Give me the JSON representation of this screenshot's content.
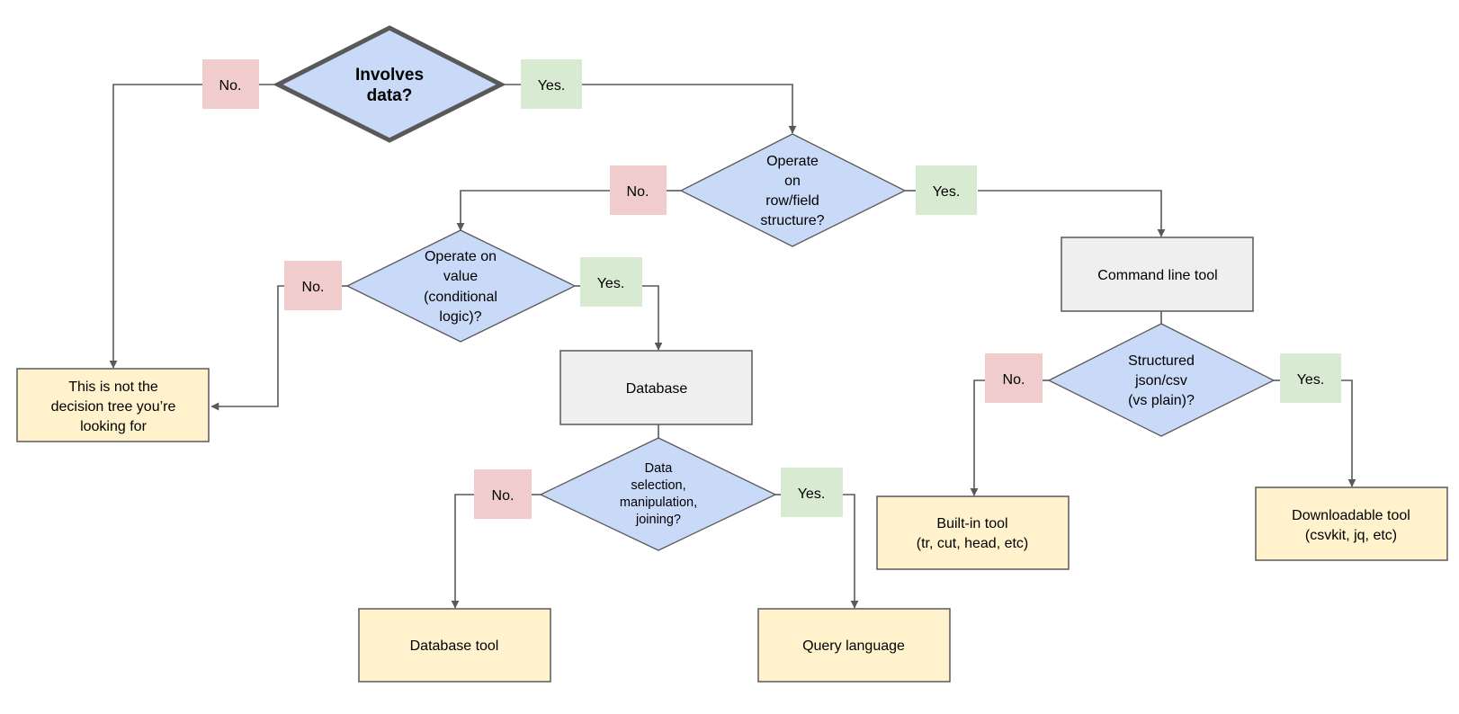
{
  "diagram": {
    "type": "decision-flowchart",
    "colors": {
      "decision_fill": "#c9daf8",
      "process_fill": "#efefef",
      "outcome_fill": "#fff2cc",
      "no_label_fill": "#f0cdcc",
      "yes_label_fill": "#d9ead3",
      "stroke": "#595959"
    },
    "labels": {
      "no": "No.",
      "yes": "Yes."
    },
    "nodes": {
      "involves_data": {
        "kind": "decision",
        "lines": [
          "Involves",
          "data?"
        ]
      },
      "row_field": {
        "kind": "decision",
        "lines": [
          "Operate",
          "on",
          "row/field",
          "structure?"
        ]
      },
      "value_logic": {
        "kind": "decision",
        "lines": [
          "Operate on",
          "value",
          "(conditional",
          "logic)?"
        ]
      },
      "not_this_tree": {
        "kind": "outcome",
        "lines": [
          "This is not the",
          "decision tree you’re",
          "looking for"
        ]
      },
      "database": {
        "kind": "process",
        "lines": [
          "Database"
        ]
      },
      "data_selection": {
        "kind": "decision",
        "lines": [
          "Data",
          "selection,",
          "manipulation,",
          "joining?"
        ]
      },
      "database_tool": {
        "kind": "outcome",
        "lines": [
          "Database tool"
        ]
      },
      "query_language": {
        "kind": "outcome",
        "lines": [
          "Query language"
        ]
      },
      "command_line_tool": {
        "kind": "process",
        "lines": [
          "Command line tool"
        ]
      },
      "structured": {
        "kind": "decision",
        "lines": [
          "Structured",
          "json/csv",
          "(vs plain)?"
        ]
      },
      "builtin_tool": {
        "kind": "outcome",
        "lines": [
          "Built-in tool",
          "(tr, cut, head, etc)"
        ]
      },
      "downloadable_tool": {
        "kind": "outcome",
        "lines": [
          "Downloadable tool",
          "(csvkit, jq, etc)"
        ]
      }
    },
    "edges": [
      {
        "from": "involves_data",
        "to": "not_this_tree",
        "label": "No."
      },
      {
        "from": "involves_data",
        "to": "row_field",
        "label": "Yes."
      },
      {
        "from": "row_field",
        "to": "value_logic",
        "label": "No."
      },
      {
        "from": "row_field",
        "to": "command_line_tool",
        "label": "Yes."
      },
      {
        "from": "value_logic",
        "to": "not_this_tree",
        "label": "No."
      },
      {
        "from": "value_logic",
        "to": "database",
        "label": "Yes."
      },
      {
        "from": "database",
        "to": "data_selection",
        "label": ""
      },
      {
        "from": "data_selection",
        "to": "database_tool",
        "label": "No."
      },
      {
        "from": "data_selection",
        "to": "query_language",
        "label": "Yes."
      },
      {
        "from": "command_line_tool",
        "to": "structured",
        "label": ""
      },
      {
        "from": "structured",
        "to": "builtin_tool",
        "label": "No."
      },
      {
        "from": "structured",
        "to": "downloadable_tool",
        "label": "Yes."
      }
    ]
  }
}
